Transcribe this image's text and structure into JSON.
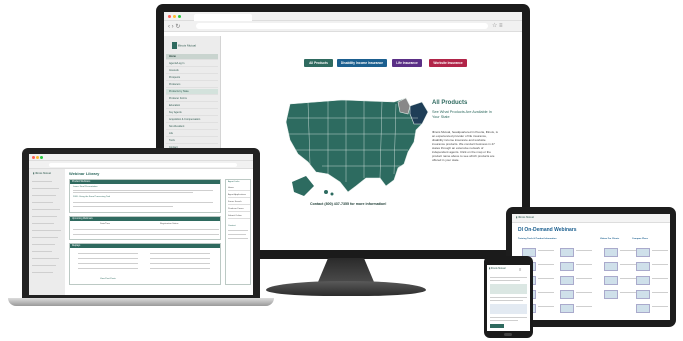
{
  "monitor": {
    "sidebar": {
      "logo_text": "Illinois Mutual",
      "items": [
        {
          "label": "Home",
          "type": "head"
        },
        {
          "label": "Agents/Log In",
          "type": "normal"
        },
        {
          "label": "Insureds",
          "type": "normal"
        },
        {
          "label": "Prospects",
          "type": "normal"
        },
        {
          "label": "Producers",
          "type": "normal"
        },
        {
          "label": "Products by State",
          "type": "active"
        },
        {
          "label": "Producer Forms",
          "type": "normal"
        },
        {
          "label": "Education",
          "type": "normal"
        },
        {
          "label": "Key Agents",
          "type": "normal"
        },
        {
          "label": "Acquisition & Compensation",
          "type": "normal"
        },
        {
          "label": "Non-Resident",
          "type": "normal"
        },
        {
          "label": "Life",
          "type": "normal"
        },
        {
          "label": "Tools",
          "type": "normal"
        },
        {
          "label": "Contact",
          "type": "normal"
        }
      ]
    },
    "buttons": [
      {
        "label": "All Products",
        "color": "#2f6a5f"
      },
      {
        "label": "Disability Income Insurance",
        "color": "#1b5f8f"
      },
      {
        "label": "Life Insurance",
        "color": "#5a2f86"
      },
      {
        "label": "Worksite Insurance",
        "color": "#b12448"
      }
    ],
    "content": {
      "heading": "All Products",
      "subheading": "See What Products Are Available In Your State",
      "body": "Illinois Mutual, headquartered in Peoria, Illinois, is an experienced provider of life insurance, disability income insurance and worksite insurance products. We conduct business in 47 states through an extensive network of independent agents. Click on the map or the product name above to see which products are offered in your state.",
      "contact": "Contact (800) 437-7355 for more information!"
    },
    "colors": {
      "accent": "#2f6a5f",
      "map": "#2d6b60",
      "map_dark": "#1f3e57"
    }
  },
  "laptop": {
    "page_title": "Webinar Library",
    "sections": [
      {
        "title": "Product Webinars",
        "rows": [
          "Learn: Final Presentation",
          "2020: Using the Form Processing Tool"
        ]
      },
      {
        "title": "Upcoming Webinars"
      },
      {
        "title": "Replays"
      }
    ],
    "right_panel": {
      "title": "Agent Links",
      "items": [
        "Home",
        "Agent Applications",
        "Forms Search",
        "Producer Forms",
        "Submit Online"
      ],
      "contact": "Contact"
    },
    "table_headers": [
      "Date/Time",
      "Registration Status"
    ],
    "footer_link": "View Past Posts"
  },
  "tablet": {
    "title": "DI On-Demand Webinars",
    "columns": [
      "Training Tools & Product Information",
      "Videos For Clients",
      "Compare Plans"
    ]
  },
  "phone": {
    "logo_text": "Illinois Mutual"
  }
}
